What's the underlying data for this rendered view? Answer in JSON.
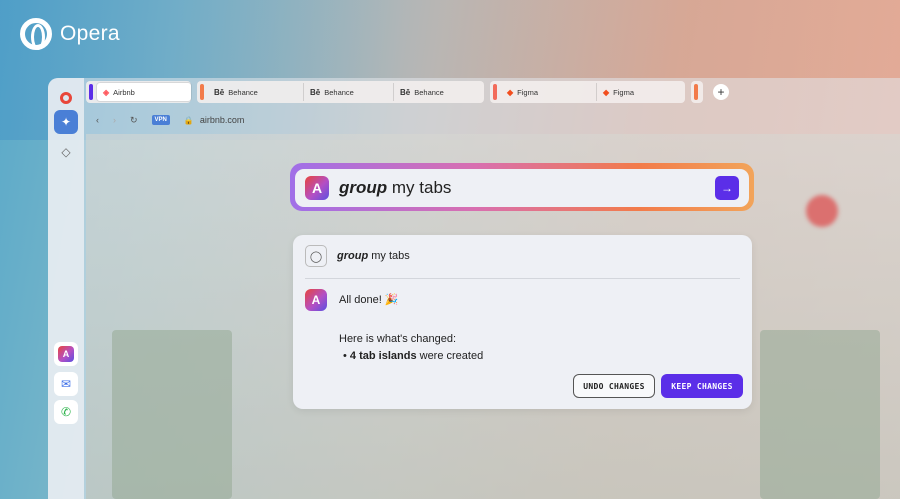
{
  "brand": {
    "name": "Opera"
  },
  "tabs": {
    "groups": [
      {
        "color": "#5b2ee8",
        "tabs": [
          {
            "label": "Airbnb",
            "favicon": "airbnb-icon",
            "active": true
          }
        ]
      },
      {
        "color": "#f27b4a",
        "tabs": [
          {
            "label": "Behance",
            "favicon": "Bē"
          },
          {
            "label": "Behance",
            "favicon": "Bē"
          },
          {
            "label": "Behance",
            "favicon": "Bē"
          }
        ]
      },
      {
        "color": "#f26b5a",
        "tabs": [
          {
            "label": "Figma",
            "favicon": "figma-icon"
          },
          {
            "label": "Figma",
            "favicon": "figma-icon"
          }
        ]
      }
    ],
    "add_tab_label": "+"
  },
  "addressbar": {
    "vpn_label": "VPN",
    "url": "airbnb.com"
  },
  "prompt": {
    "emphasis": "group",
    "rest": " my tabs",
    "send_icon": "→"
  },
  "panel": {
    "user_emphasis": "group",
    "user_rest": " my tabs",
    "done_text": "All done! 🎉",
    "changed_title": "Here is what's changed:",
    "bullet_emphasis": "4 tab islands",
    "bullet_rest": " were created",
    "undo_label": "UNDO CHANGES",
    "keep_label": "KEEP CHANGES"
  },
  "colors": {
    "accent": "#5b2ee8",
    "opera_red": "#e8463a"
  }
}
